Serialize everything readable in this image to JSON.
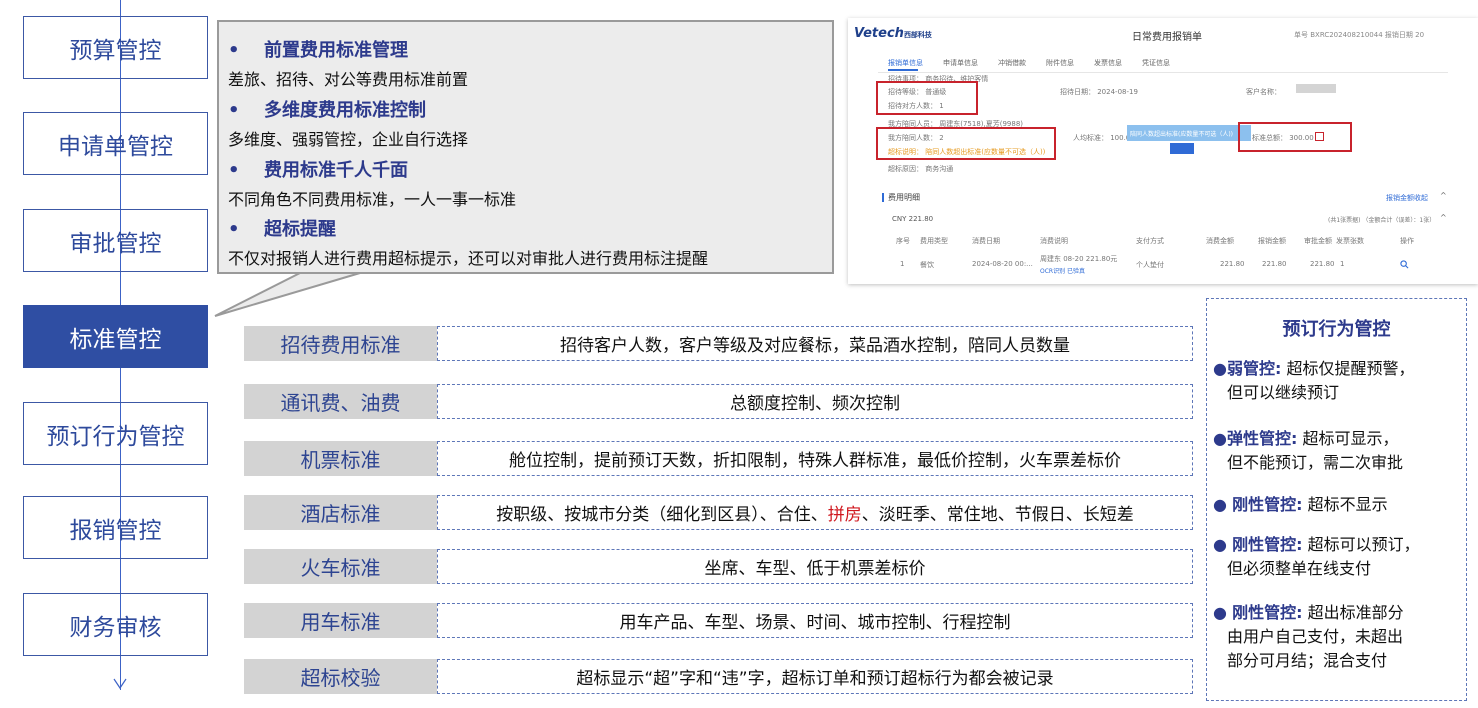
{
  "nav": {
    "items": [
      {
        "label": "预算管控",
        "active": false
      },
      {
        "label": "申请单管控",
        "active": false
      },
      {
        "label": "审批管控",
        "active": false
      },
      {
        "label": "标准管控",
        "active": true
      },
      {
        "label": "预订行为管控",
        "active": false
      },
      {
        "label": "报销管控",
        "active": false
      },
      {
        "label": "财务审核",
        "active": false
      }
    ]
  },
  "callout": {
    "bullet": "•",
    "features": [
      {
        "title": "前置费用标准管理",
        "desc": "差旅、招待、对公等费用标准前置"
      },
      {
        "title": "多维度费用标准控制",
        "desc": "多维度、强弱管控，企业自行选择"
      },
      {
        "title": "费用标准千人千面",
        "desc": "不同角色不同费用标准，一人一事一标准"
      },
      {
        "title": "超标提醒",
        "desc": "不仅对报销人进行费用超标提示，还可以对审批人进行费用标注提醒"
      }
    ]
  },
  "screenshot": {
    "logo": "Vetech",
    "logo_sub": "西部科技",
    "form_title": "日常费用报销单",
    "form_no": "单号 BXRC20240821004​4   报销日期 20",
    "tabs": [
      "报销单信息",
      "申请单信息",
      "冲销借款",
      "附件信息",
      "发票信息",
      "凭证信息"
    ],
    "fields": {
      "reason_type": "招待事项：  商务招待、维护客情",
      "level": "招待等级：  普通级",
      "guests": "招待对方人数：  1",
      "date": "招待日期：  2024-08-19",
      "customer": "客户名称：",
      "companions": "我方陪同人员：  周建东(7518),夏芳(9988)",
      "companion_count": "我方陪同人数：  2",
      "per_person": "人均标准：  100.00",
      "total_std": "标准总额：  300.00",
      "over_note": "超标说明：  陪同人数超出标准(应数量不可选（人))",
      "tip": "陪同人数超出标准(应数量不可选（人))",
      "over_reason": "超标原因：  商务沟通",
      "section": "费用明细",
      "collapse": "报销金额收起",
      "currency": "CNY 221.80",
      "summary": "(共1张票据) （金额合计（误差）：1张）",
      "headers": [
        "序号",
        "费用类型",
        "消费日期",
        "消费说明",
        "支付方式",
        "消费金额",
        "报销金额",
        "审批金额",
        "发票张数",
        "操作"
      ],
      "row": [
        "1",
        "餐饮",
        "2024-08-20 00:...",
        "周建东 08-20 221.80元",
        "个人垫付",
        "221.80",
        "221.80",
        "221.80",
        "1"
      ],
      "row_tags": "OCR识别   已验真"
    }
  },
  "standards": [
    {
      "label": "招待费用标准",
      "desc": [
        "招待客户人数，客户等级及对应餐标，菜品酒水控制，陪同人员数量"
      ]
    },
    {
      "label": "通讯费、油费",
      "desc": [
        "总额度控制、频次控制"
      ]
    },
    {
      "label": "机票标准",
      "desc": [
        "舱位控制，提前预订天数，折扣限制，特殊人群标准，最低价控制，火车票差标价"
      ]
    },
    {
      "label": "酒店标准",
      "desc_before": "按职级、按城市分类（细化到区县）、合住、",
      "desc_hl": "拼房",
      "desc_after": "、淡旺季、常住地、节假日、长短差"
    },
    {
      "label": "火车标准",
      "desc": [
        "坐席、车型、低于机票差标价"
      ]
    },
    {
      "label": "用车标准",
      "desc": [
        "用车产品、车型、场景、时间、城市控制、行程控制"
      ]
    },
    {
      "label": "超标校验",
      "desc": [
        "超标显示“超”字和“违”字，超标订单和预订超标行为都会被记录"
      ]
    }
  ],
  "panel": {
    "title": "预订行为管控",
    "items": [
      {
        "mark": "●",
        "label": "弱管控:",
        "line1": "超标仅提醒预警，",
        "line2": "但可以继续预订"
      },
      {
        "mark": "●",
        "label": "弹性管控:",
        "line1": "超标可显示，",
        "line2": "但不能预订，需二次审批"
      },
      {
        "mark": "●",
        "label": "刚性管控:",
        "line1": "超标不显示",
        "line2": ""
      },
      {
        "mark": "●",
        "label": "刚性管控:",
        "line1": "超标可以预订，",
        "line2": "但必须整单在线支付"
      },
      {
        "mark": "●",
        "label": "刚性管控:",
        "line1": "超出标准部分",
        "line2": "由用户自己支付，未超出",
        "line3": "部分可月结；混合支付"
      }
    ]
  },
  "colors": {
    "accent": "#2f4ea3",
    "title_blue": "#2d3a8c",
    "highlight_red": "#d0181f",
    "box_red": "#c8232c"
  }
}
